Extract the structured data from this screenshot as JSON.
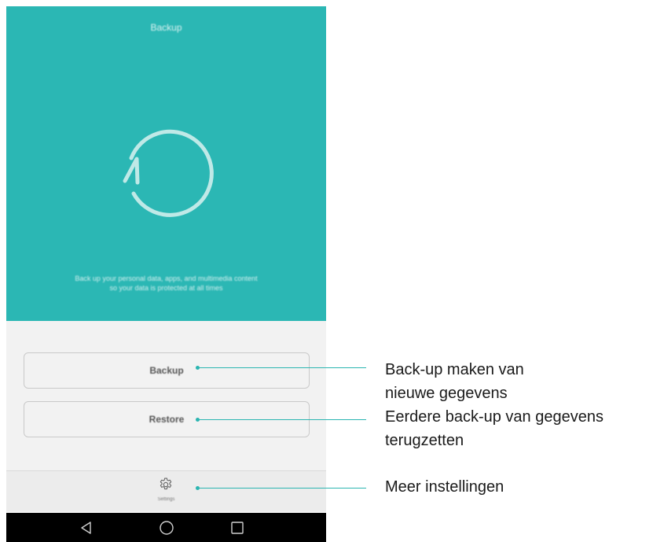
{
  "colors": {
    "accent": "#2bb7b4",
    "callout": "#2bb5b1"
  },
  "header": {
    "title": "Backup"
  },
  "hero": {
    "icon": "refresh-icon",
    "description_line1": "Back up your personal data, apps, and multimedia content",
    "description_line2": "so your data is protected at all times"
  },
  "actions": {
    "backup_label": "Backup",
    "restore_label": "Restore"
  },
  "bottom_bar": {
    "settings_icon": "gear-icon",
    "settings_label": "Settings"
  },
  "navbar": {
    "back_icon": "back-triangle-icon",
    "home_icon": "home-circle-icon",
    "recents_icon": "recents-square-icon"
  },
  "callouts": {
    "backup_line1": "Back-up maken van",
    "backup_line2": "nieuwe gegevens",
    "restore_line1": "Eerdere back-up van gegevens",
    "restore_line2": "terugzetten",
    "settings": "Meer instellingen"
  }
}
